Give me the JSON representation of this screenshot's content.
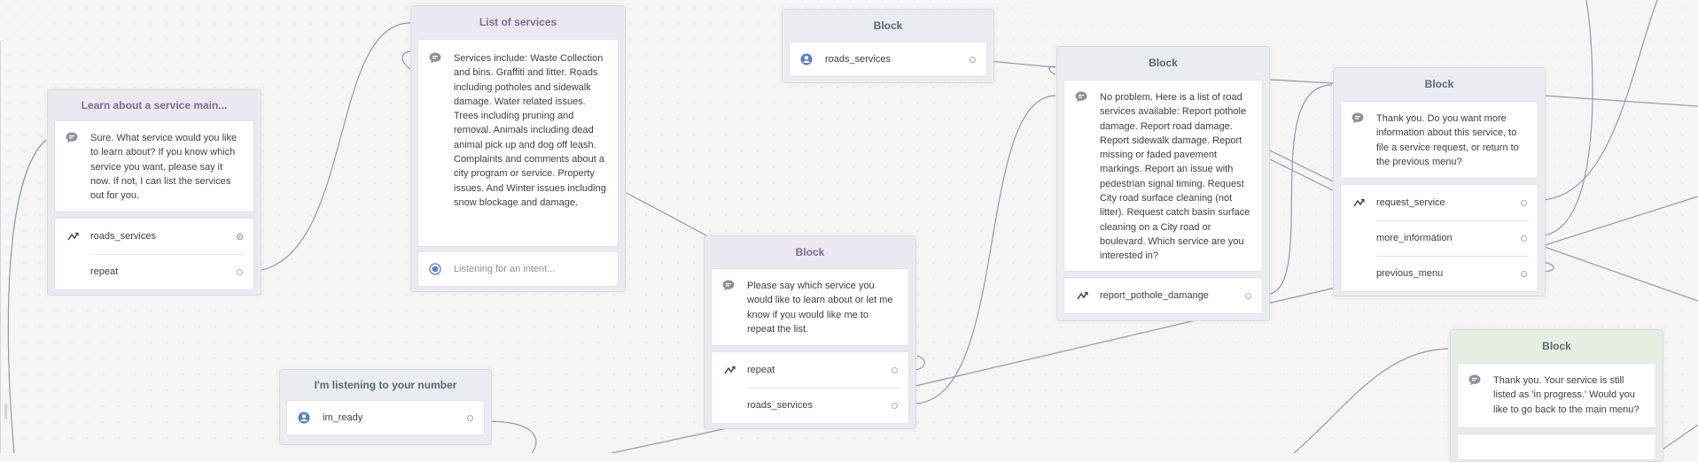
{
  "colors": {
    "canvas": "#f5f5f6",
    "connector": "#8e9aad",
    "intent_icon": "#5b7fc4"
  },
  "blocks": {
    "learn": {
      "title": "Learn about a service main...",
      "message": "Sure. What service would you like to learn about? If you know which service you want, please say it now. If not, I can list the services out for you.",
      "rows": [
        "roads_services",
        "repeat"
      ]
    },
    "list_services": {
      "title": "List of services",
      "message": "Services include: Waste Collection and bins. Graffiti and litter. Roads including potholes and sidewalk damage. Water related issues. Trees including pruning and removal. Animals including dead animal pick up and dog off leash. Complaints and comments about a city program or service. Property issues. And Winter issues including snow blockage and damage.",
      "listening": "Listening for an intent..."
    },
    "listening_number": {
      "title": "I'm listening to your number",
      "intent": "im_ready"
    },
    "block_roads_intent": {
      "title": "Block",
      "intent": "roads_services"
    },
    "block_say_which": {
      "title": "Block",
      "message": "Please say which service you would like to learn about or let me know if you would like me to repeat the list.",
      "rows": [
        "repeat",
        "roads_services"
      ]
    },
    "block_road_list": {
      "title": "Block",
      "message": "No problem. Here is a list of road services available: Report pothole damage. Report road damage. Report sidewalk damage. Report missing or faded pavement markings. Report an issue with pedestrian signal timing. Request City road surface cleaning (not litter). Request catch basin surface cleaning on a City road or boulevard. Which service are you interested in?",
      "rows": [
        "report_pothole_damange"
      ]
    },
    "block_thank_you": {
      "title": "Block",
      "message": "Thank you. Do you want more information about this service, to file a service request, or return to the previous menu?",
      "rows": [
        "request_service",
        "more_information",
        "previous_menu"
      ]
    },
    "block_in_progress": {
      "title": "Block",
      "message": "Thank you. Your service is still listed as 'in progress.' Would you like to go back to the main menu?"
    }
  },
  "icons": {
    "message": "speech-bubble-icon",
    "branch": "branch-icon",
    "intent": "user-icon",
    "listening": "radio-listen-icon"
  }
}
